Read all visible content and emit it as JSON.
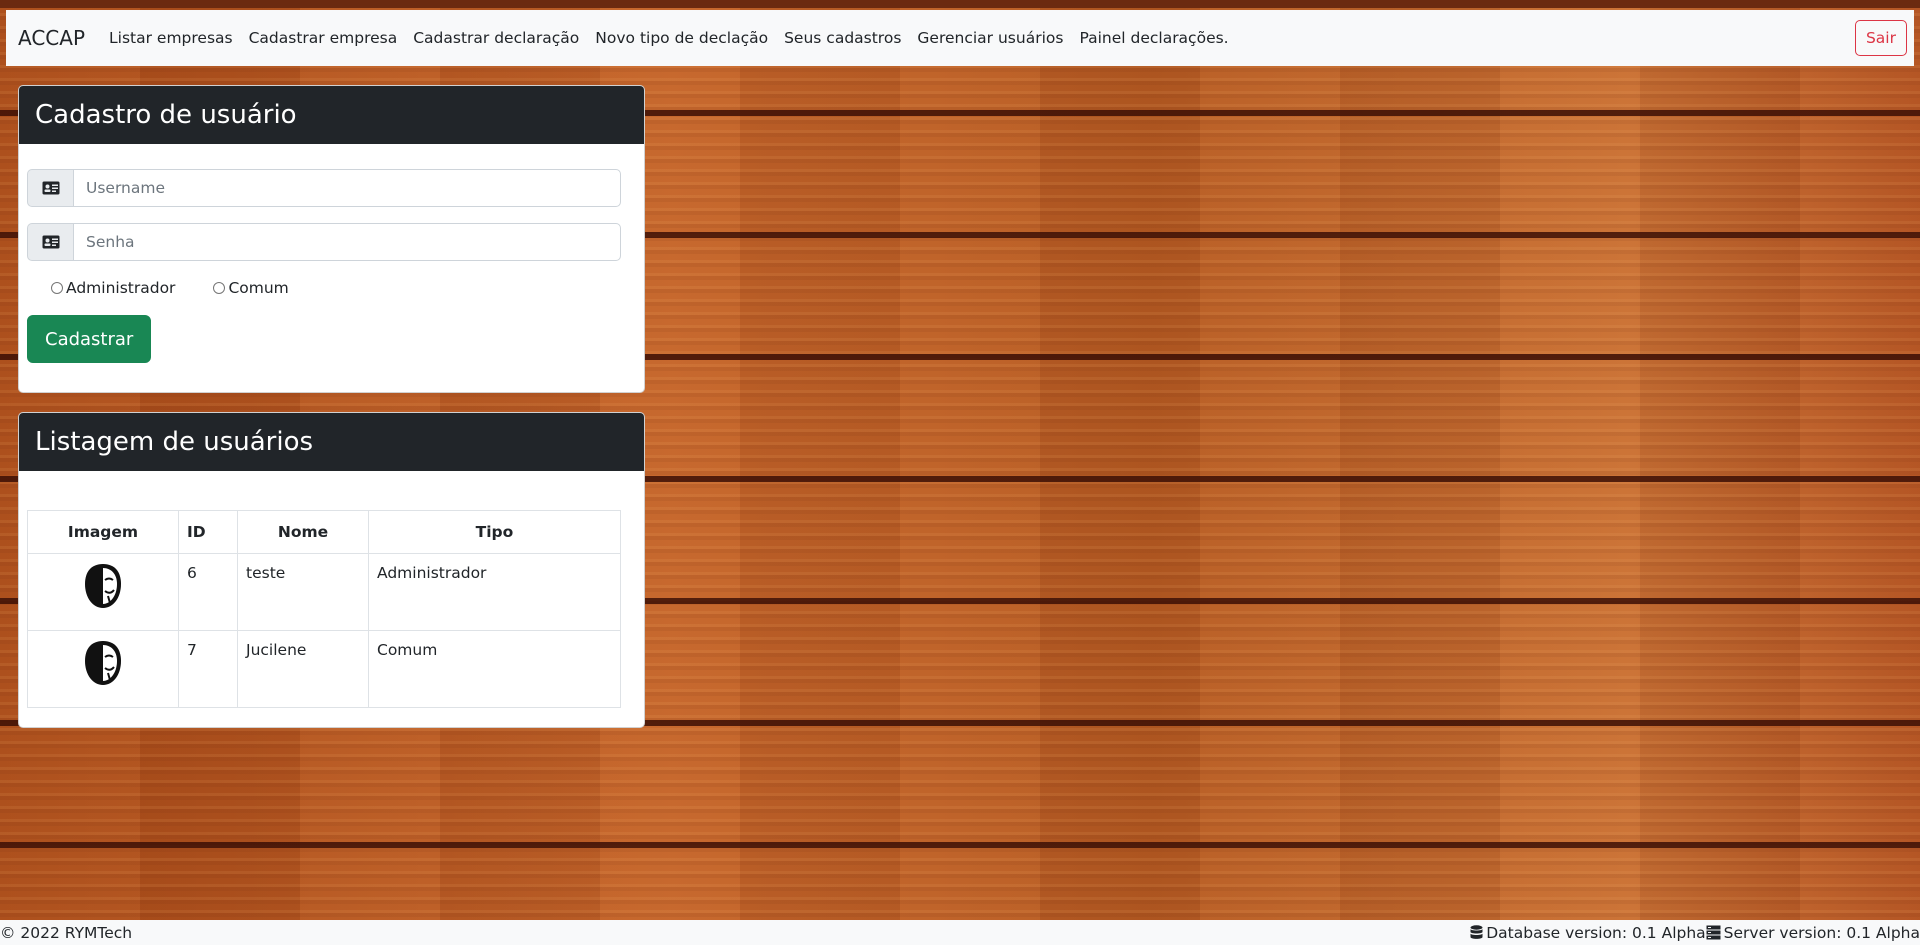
{
  "nav": {
    "brand": "ACCAP",
    "links": [
      "Listar empresas",
      "Cadastrar empresa",
      "Cadastrar declaração",
      "Novo tipo de declação",
      "Seus cadastros",
      "Gerenciar usuários",
      "Painel declarações."
    ],
    "logout": "Sair"
  },
  "register": {
    "title": "Cadastro de usuário",
    "username_placeholder": "Username",
    "username_value": "",
    "password_placeholder": "Senha",
    "password_value": "",
    "roles": [
      "Administrador",
      "Comum"
    ],
    "submit": "Cadastrar",
    "field_icon": "id-card-icon"
  },
  "listing": {
    "title": "Listagem de usuários",
    "columns": [
      "Imagem",
      "ID",
      "Nome",
      "Tipo"
    ],
    "rows": [
      {
        "id": "6",
        "name": "teste",
        "type": "Administrador",
        "avatar_icon": "mask-avatar-icon"
      },
      {
        "id": "7",
        "name": "Jucilene",
        "type": "Comum",
        "avatar_icon": "mask-avatar-icon"
      }
    ]
  },
  "footer": {
    "copyright": "© 2022 RYMTech",
    "db_version": "Database version: 0.1 Alpha",
    "server_version": "Server version: 0.1 Alpha"
  },
  "colors": {
    "header_dark": "#212529",
    "success": "#198754",
    "danger": "#dc3545",
    "navbar": "#f8f9fa"
  }
}
